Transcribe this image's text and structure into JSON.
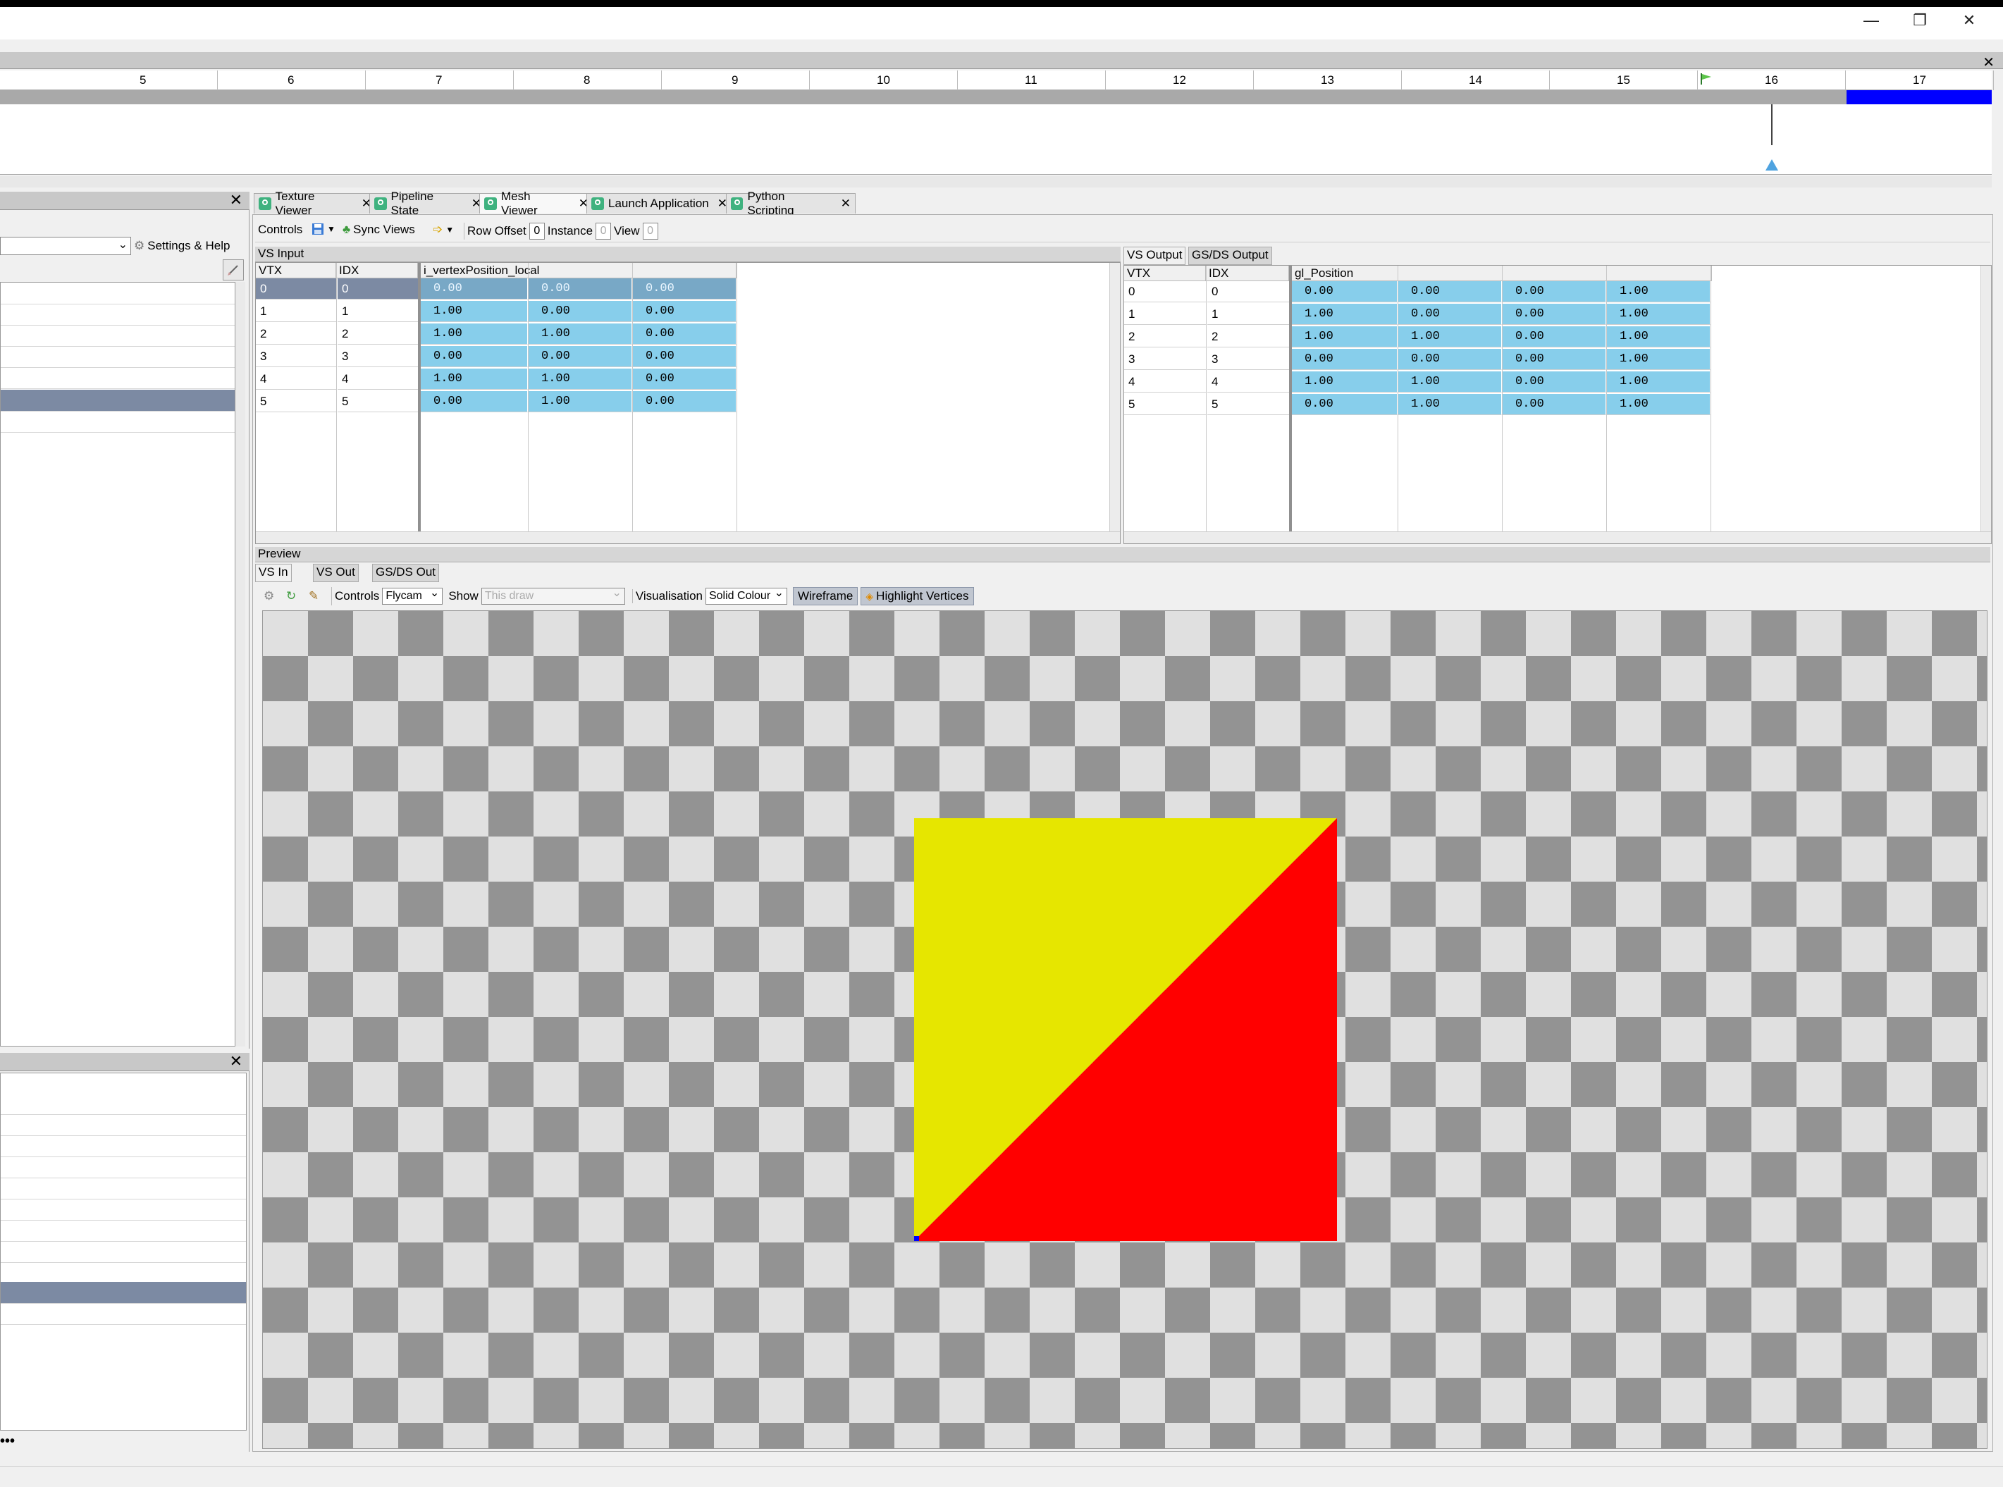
{
  "window": {
    "controls": {
      "minimize": "—",
      "maximize": "❐",
      "close": "✕"
    }
  },
  "timeline": {
    "ticks": [
      "5",
      "6",
      "7",
      "8",
      "9",
      "10",
      "11",
      "12",
      "13",
      "14",
      "15",
      "16",
      "17"
    ],
    "close": "✕"
  },
  "left_panel": {
    "settings_label": "Settings & Help",
    "close": "✕"
  },
  "left_panel_bottom": {
    "close": "✕",
    "more": "•••"
  },
  "tabs": [
    {
      "label": "Texture Viewer",
      "close": "✕"
    },
    {
      "label": "Pipeline State",
      "close": "✕"
    },
    {
      "label": "Mesh Viewer",
      "close": "✕"
    },
    {
      "label": "Launch Application",
      "close": "✕"
    },
    {
      "label": "Python Scripting",
      "close": "✕"
    }
  ],
  "toolbar": {
    "controls_label": "Controls",
    "sync_views_label": "Sync Views",
    "row_offset_label": "Row Offset",
    "row_offset_value": "0",
    "instance_label": "Instance",
    "instance_value": "0",
    "view_label": "View",
    "view_value": "0"
  },
  "vs_input": {
    "title": "VS Input",
    "columns": [
      "VTX",
      "IDX",
      "i_vertexPosition_local"
    ],
    "rows": [
      {
        "vtx": "0",
        "idx": "0",
        "values": [
          "0.00",
          "0.00",
          "0.00"
        ]
      },
      {
        "vtx": "1",
        "idx": "1",
        "values": [
          "1.00",
          "0.00",
          "0.00"
        ]
      },
      {
        "vtx": "2",
        "idx": "2",
        "values": [
          "1.00",
          "1.00",
          "0.00"
        ]
      },
      {
        "vtx": "3",
        "idx": "3",
        "values": [
          "0.00",
          "0.00",
          "0.00"
        ]
      },
      {
        "vtx": "4",
        "idx": "4",
        "values": [
          "1.00",
          "1.00",
          "0.00"
        ]
      },
      {
        "vtx": "5",
        "idx": "5",
        "values": [
          "0.00",
          "1.00",
          "0.00"
        ]
      }
    ],
    "selected_row": 0
  },
  "vs_output": {
    "tabs": [
      "VS Output",
      "GS/DS Output"
    ],
    "columns": [
      "VTX",
      "IDX",
      "gl_Position"
    ],
    "rows": [
      {
        "vtx": "0",
        "idx": "0",
        "values": [
          "0.00",
          "0.00",
          "0.00",
          "1.00"
        ]
      },
      {
        "vtx": "1",
        "idx": "1",
        "values": [
          "1.00",
          "0.00",
          "0.00",
          "1.00"
        ]
      },
      {
        "vtx": "2",
        "idx": "2",
        "values": [
          "1.00",
          "1.00",
          "0.00",
          "1.00"
        ]
      },
      {
        "vtx": "3",
        "idx": "3",
        "values": [
          "0.00",
          "0.00",
          "0.00",
          "1.00"
        ]
      },
      {
        "vtx": "4",
        "idx": "4",
        "values": [
          "1.00",
          "1.00",
          "0.00",
          "1.00"
        ]
      },
      {
        "vtx": "5",
        "idx": "5",
        "values": [
          "0.00",
          "1.00",
          "0.00",
          "1.00"
        ]
      }
    ]
  },
  "preview": {
    "title": "Preview",
    "tabs": [
      "VS In",
      "VS Out",
      "GS/DS Out"
    ],
    "controls_label": "Controls",
    "controls_value": "Flycam",
    "show_label": "Show",
    "show_value": "This draw",
    "visualisation_label": "Visualisation",
    "visualisation_value": "Solid Colour",
    "wireframe_label": "Wireframe",
    "highlight_label": "Highlight Vertices",
    "triangle_colors": {
      "upper": "#e6e600",
      "lower": "#ff0000"
    },
    "checker_colors": {
      "dark": "#939393",
      "light": "#e0e0e0"
    }
  }
}
